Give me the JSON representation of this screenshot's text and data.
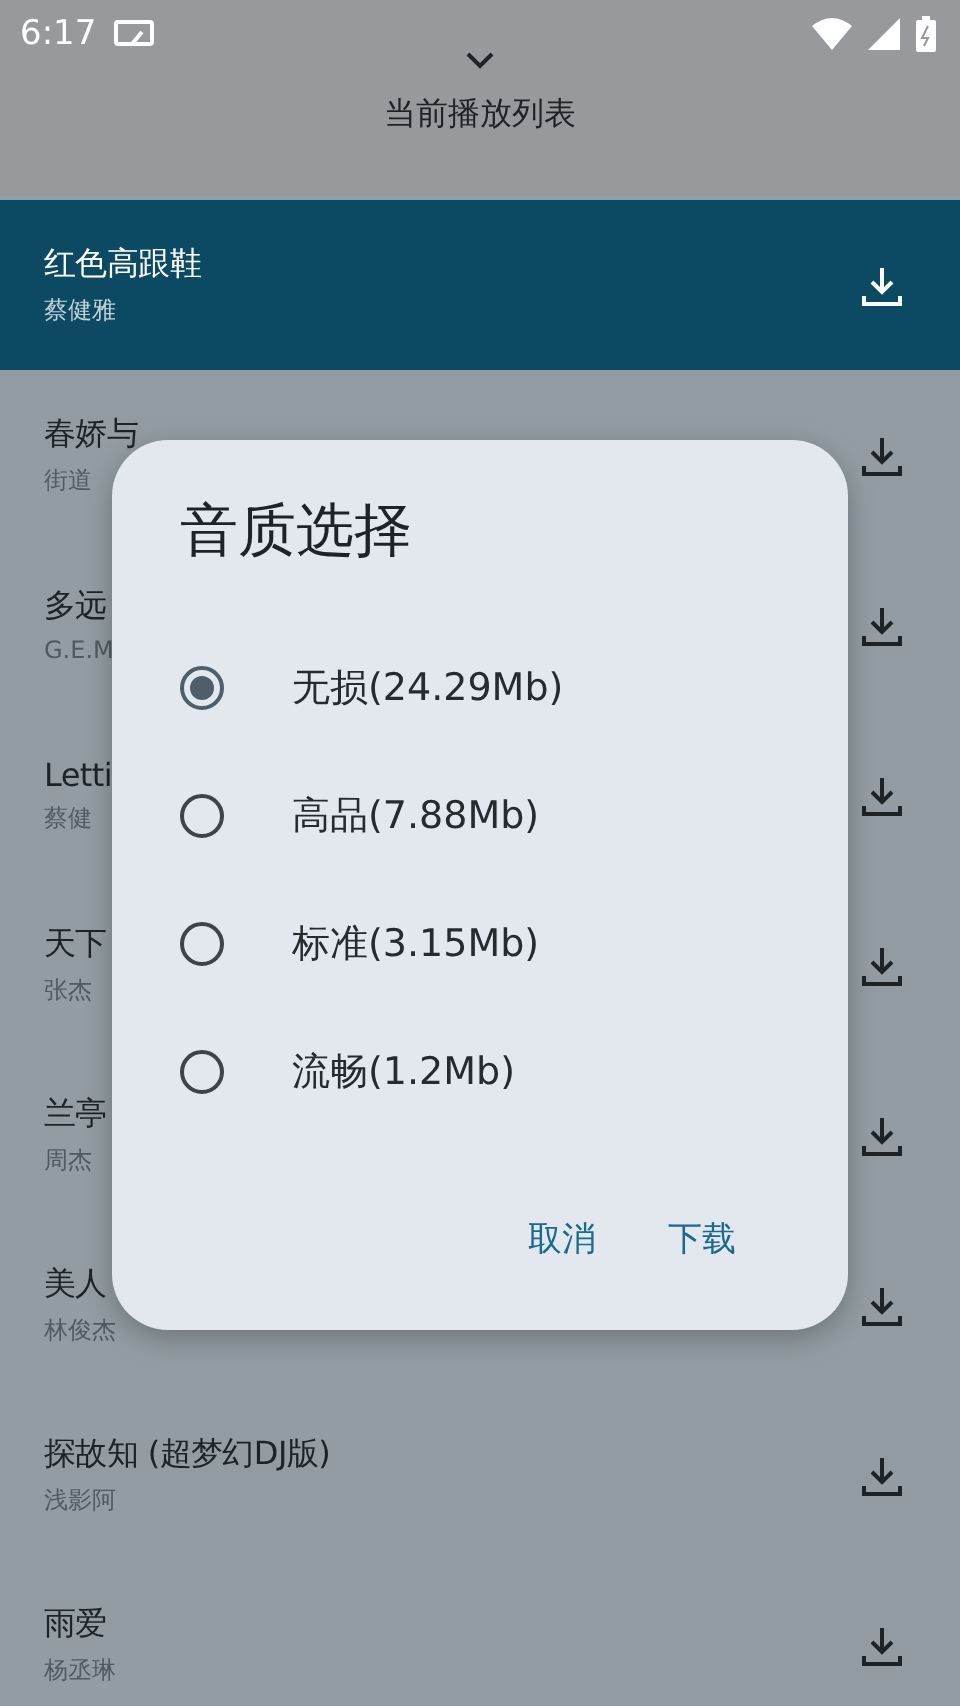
{
  "status_bar": {
    "time": "6:17"
  },
  "header": {
    "title": "当前播放列表"
  },
  "songs": [
    {
      "title": "红色高跟鞋",
      "artist": "蔡健雅",
      "selected": true
    },
    {
      "title": "春娇与",
      "artist": "街道",
      "selected": false
    },
    {
      "title": "多远",
      "artist": "G.E.M",
      "selected": false
    },
    {
      "title": "Letti",
      "artist": "蔡健",
      "selected": false
    },
    {
      "title": "天下",
      "artist": "张杰",
      "selected": false
    },
    {
      "title": "兰亭",
      "artist": "周杰",
      "selected": false
    },
    {
      "title": "美人",
      "artist": "林俊杰",
      "selected": false
    },
    {
      "title": "探故知 (超梦幻DJ版)",
      "artist": "浅影阿",
      "selected": false
    },
    {
      "title": "雨爱",
      "artist": "杨丞琳",
      "selected": false
    }
  ],
  "dialog": {
    "title": "音质选择",
    "options": [
      {
        "label": "无损(24.29Mb)",
        "selected": true
      },
      {
        "label": "高品(7.88Mb)",
        "selected": false
      },
      {
        "label": "标准(3.15Mb)",
        "selected": false
      },
      {
        "label": "流畅(1.2Mb)",
        "selected": false
      }
    ],
    "buttons": [
      "取消",
      "下载"
    ]
  }
}
